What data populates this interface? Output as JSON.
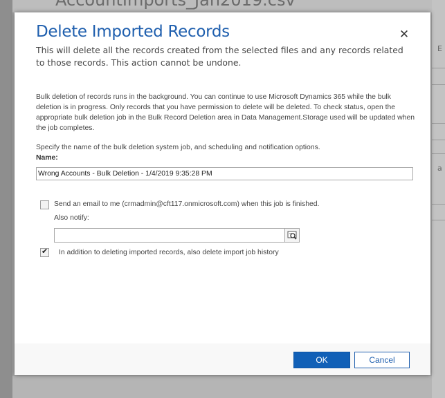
{
  "background": {
    "page_title": "AccountImports_Jan2019.csv",
    "right_fragments": [
      "E",
      "a"
    ]
  },
  "dialog": {
    "title": "Delete Imported Records",
    "close_icon": "close-icon",
    "subtitle": "This will delete all the records created from the selected files and any records related to those records. This action cannot be undone.",
    "info": "Bulk deletion of records runs in the background. You can continue to use Microsoft Dynamics 365 while the bulk deletion is in progress. Only records that you have permission to delete will be deleted. To check status, open the appropriate bulk deletion job in the Bulk Record Deletion area in Data Management.Storage used will be updated when the job completes.",
    "specify_text": "Specify the name of the bulk deletion system job, and scheduling and notification options.",
    "name_label": "Name:",
    "name_value": "Wrong Accounts - Bulk Deletion - 1/4/2019 9:35:28 PM",
    "email_checkbox": {
      "label": "Send an email to me (crmadmin@cft117.onmicrosoft.com) when this job is finished.",
      "checked": false
    },
    "also_notify_label": "Also notify:",
    "also_notify_value": "",
    "lookup_icon": "lookup-icon",
    "history_checkbox": {
      "label": "In addition to deleting imported records, also delete import job history",
      "checked": true
    },
    "buttons": {
      "ok": "OK",
      "cancel": "Cancel"
    }
  },
  "colors": {
    "title": "#1f5fae",
    "primary_button": "#1160b7",
    "overlay": "#a8a8a8"
  }
}
